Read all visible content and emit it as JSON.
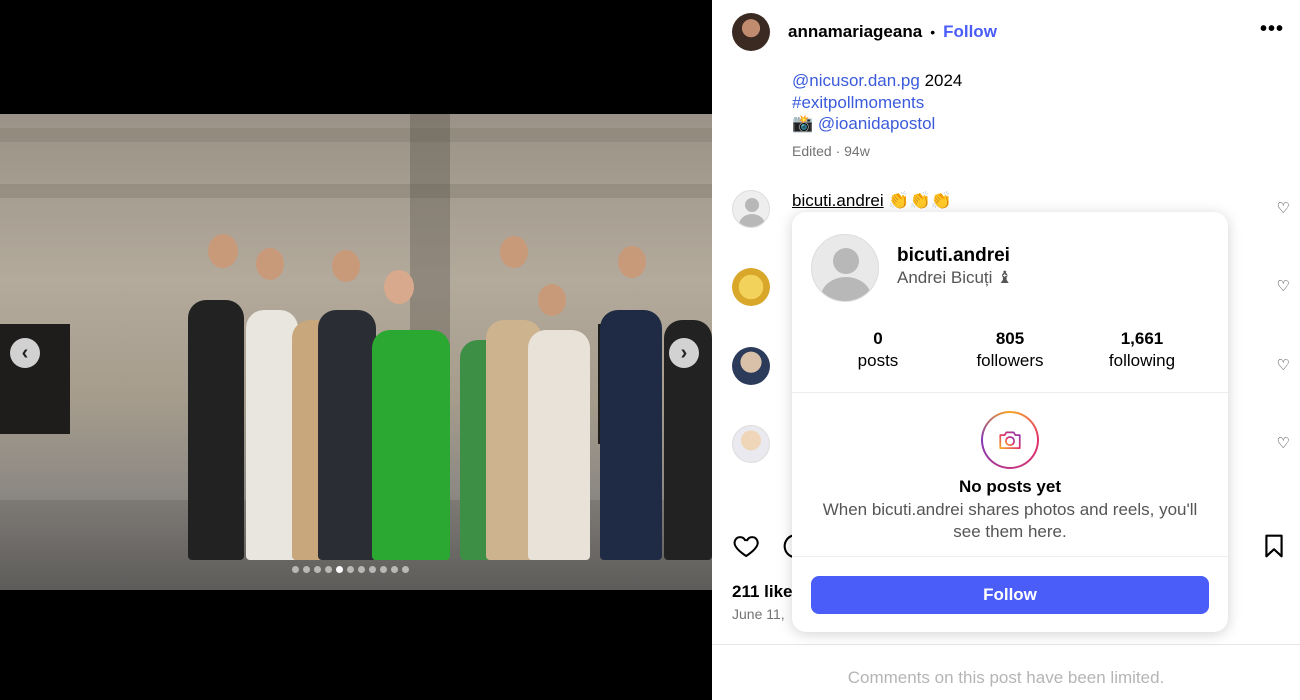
{
  "post": {
    "author": "annamariageana",
    "separator": "•",
    "follow_label": "Follow",
    "more_icon": "more-horizontal-icon",
    "caption_lines": [
      {
        "link": "@nicusor.dan.pg",
        "text": " 2024"
      },
      {
        "link": "#exitpollmoments",
        "text": ""
      },
      {
        "prefix": "📸 ",
        "link": "@ioanidapostol",
        "text": ""
      }
    ],
    "meta": "Edited · 94w",
    "likes": "211 likes",
    "date": "June 11,",
    "comments_limited": "Comments on this post have been limited."
  },
  "comments": [
    {
      "username": "bicuti.andrei",
      "text": " 👏👏👏"
    }
  ],
  "carousel": {
    "dot_count": 11,
    "active_index": 4,
    "prev_icon": "chevron-left-icon",
    "next_icon": "chevron-right-icon"
  },
  "hover_card": {
    "username": "bicuti.andrei",
    "full_name": "Andrei Bicuți ♝",
    "stats": [
      {
        "value": "0",
        "label": "posts"
      },
      {
        "value": "805",
        "label": "followers"
      },
      {
        "value": "1,661",
        "label": "following"
      }
    ],
    "no_posts_title": "No posts yet",
    "no_posts_text": "When bicuti.andrei shares photos and reels, you'll see them here.",
    "follow_label": "Follow"
  },
  "colors": {
    "accent": "#4a5df9",
    "link": "#3b5bdb",
    "muted": "#737373"
  }
}
